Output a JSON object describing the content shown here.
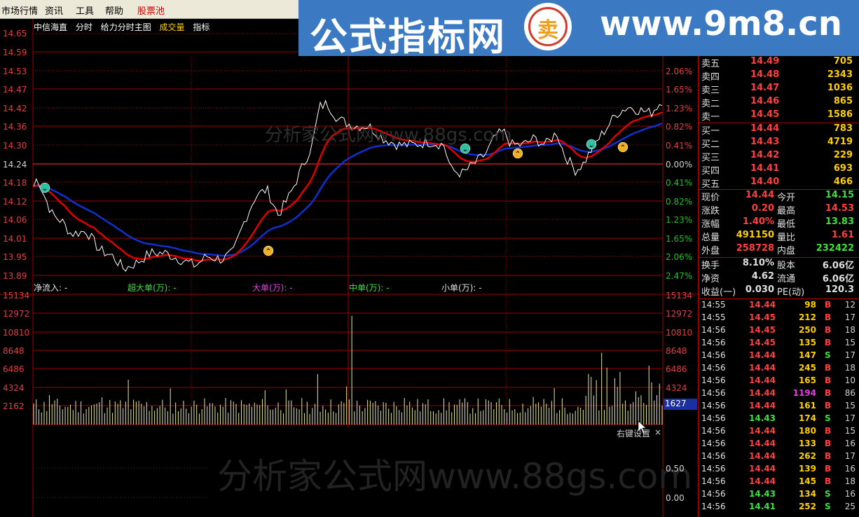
{
  "menu": [
    "市场行情",
    "资讯",
    "工具",
    "帮助",
    "股票池"
  ],
  "banner": {
    "title": "公式指标网",
    "logo_glyph": "卖",
    "url": "www.9m8.cn"
  },
  "toolbar": {
    "stock": "中信海直",
    "items": [
      "分时",
      "给力分时主图",
      "成交量",
      "指标"
    ]
  },
  "price_axis": [
    "14.65",
    "14.59",
    "14.53",
    "14.47",
    "14.42",
    "14.36",
    "14.30",
    "14.24",
    "14.18",
    "14.12",
    "14.06",
    "14.01",
    "13.95",
    "13.89"
  ],
  "pct_axis": [
    "2.06%",
    "1.65%",
    "1.23%",
    "0.82%",
    "0.41%",
    "0.00%",
    "0.41%",
    "0.82%",
    "1.23%",
    "1.65%",
    "2.06%",
    "2.47%"
  ],
  "vol_axis": [
    "15134",
    "12972",
    "10810",
    "8648",
    "6486",
    "4324",
    "2162"
  ],
  "ind_axis": [
    "0.50",
    "0.00"
  ],
  "flow": {
    "net": "净流入: -",
    "super": "超大单(万): -",
    "large": "大单(万): -",
    "mid": "中单(万): -",
    "small": "小单(万): -"
  },
  "current_vol": "1627",
  "right_key": "右键设置",
  "watermark": "分析家公式网www.88gs.com",
  "watermark2": "分析家公式网www.88gs.com",
  "colors": {
    "price_line": "#ffffff",
    "avg_red": "#e00000",
    "avg_blue": "#1030d0",
    "grid": "#a00000",
    "volume": "#e8e8a0"
  },
  "asks": [
    {
      "label": "卖五",
      "price": "14.49",
      "vol": "705"
    },
    {
      "label": "卖四",
      "price": "14.48",
      "vol": "2343"
    },
    {
      "label": "卖三",
      "price": "14.47",
      "vol": "1036"
    },
    {
      "label": "卖二",
      "price": "14.46",
      "vol": "865"
    },
    {
      "label": "卖一",
      "price": "14.45",
      "vol": "1586"
    }
  ],
  "bids": [
    {
      "label": "买一",
      "price": "14.44",
      "vol": "783"
    },
    {
      "label": "买二",
      "price": "14.43",
      "vol": "4719"
    },
    {
      "label": "买三",
      "price": "14.42",
      "vol": "229"
    },
    {
      "label": "买四",
      "price": "14.41",
      "vol": "693"
    },
    {
      "label": "买五",
      "price": "14.40",
      "vol": "466"
    }
  ],
  "quote": [
    {
      "l": "现价",
      "v": "14.44",
      "vc": "#ff4040",
      "l2": "今开",
      "v2": "14.15",
      "v2c": "#40e040"
    },
    {
      "l": "涨跌",
      "v": "0.20",
      "vc": "#ff4040",
      "l2": "最高",
      "v2": "14.53",
      "v2c": "#ff4040"
    },
    {
      "l": "涨幅",
      "v": "1.40%",
      "vc": "#ff4040",
      "l2": "最低",
      "v2": "13.83",
      "v2c": "#40e040"
    },
    {
      "l": "总量",
      "v": "491150",
      "vc": "#ffd000",
      "l2": "量比",
      "v2": "1.61",
      "v2c": "#ff4040"
    },
    {
      "l": "外盘",
      "v": "258728",
      "vc": "#ff4040",
      "l2": "内盘",
      "v2": "232422",
      "v2c": "#40e040"
    }
  ],
  "quote2": [
    {
      "l": "换手",
      "v": "8.10%",
      "vc": "#e0e0e0",
      "l2": "股本",
      "v2": "6.06亿",
      "v2c": "#e0e0e0"
    },
    {
      "l": "净资",
      "v": "4.62",
      "vc": "#e0e0e0",
      "l2": "流通",
      "v2": "6.06亿",
      "v2c": "#e0e0e0"
    },
    {
      "l": "收益(一)",
      "v": "0.030",
      "vc": "#e0e0e0",
      "l2": "PE(动)",
      "v2": "120.3",
      "v2c": "#e0e0e0"
    }
  ],
  "ticks": [
    {
      "t": "14:55",
      "p": "14.44",
      "v": "98",
      "bs": "B",
      "n": "12"
    },
    {
      "t": "14:55",
      "p": "14.45",
      "v": "212",
      "bs": "B",
      "n": "17"
    },
    {
      "t": "14:56",
      "p": "14.45",
      "v": "250",
      "bs": "B",
      "n": "18"
    },
    {
      "t": "14:56",
      "p": "14.45",
      "v": "135",
      "bs": "B",
      "n": "15"
    },
    {
      "t": "14:56",
      "p": "14.44",
      "v": "147",
      "bs": "S",
      "n": "17"
    },
    {
      "t": "14:56",
      "p": "14.44",
      "v": "245",
      "bs": "B",
      "n": "18"
    },
    {
      "t": "14:56",
      "p": "14.44",
      "v": "165",
      "bs": "B",
      "n": "10"
    },
    {
      "t": "14:56",
      "p": "14.44",
      "v": "1194",
      "bs": "B",
      "n": "86",
      "big": true
    },
    {
      "t": "14:56",
      "p": "14.44",
      "v": "161",
      "bs": "B",
      "n": "15"
    },
    {
      "t": "14:56",
      "p": "14.43",
      "v": "174",
      "bs": "S",
      "n": "17"
    },
    {
      "t": "14:56",
      "p": "14.44",
      "v": "180",
      "bs": "B",
      "n": "15"
    },
    {
      "t": "14:56",
      "p": "14.44",
      "v": "133",
      "bs": "B",
      "n": "16"
    },
    {
      "t": "14:56",
      "p": "14.44",
      "v": "262",
      "bs": "B",
      "n": "17"
    },
    {
      "t": "14:56",
      "p": "14.44",
      "v": "139",
      "bs": "B",
      "n": "16"
    },
    {
      "t": "14:56",
      "p": "14.44",
      "v": "145",
      "bs": "B",
      "n": "18"
    },
    {
      "t": "14:56",
      "p": "14.43",
      "v": "134",
      "bs": "S",
      "n": "16"
    },
    {
      "t": "14:56",
      "p": "14.41",
      "v": "252",
      "bs": "S",
      "n": "25"
    }
  ]
}
